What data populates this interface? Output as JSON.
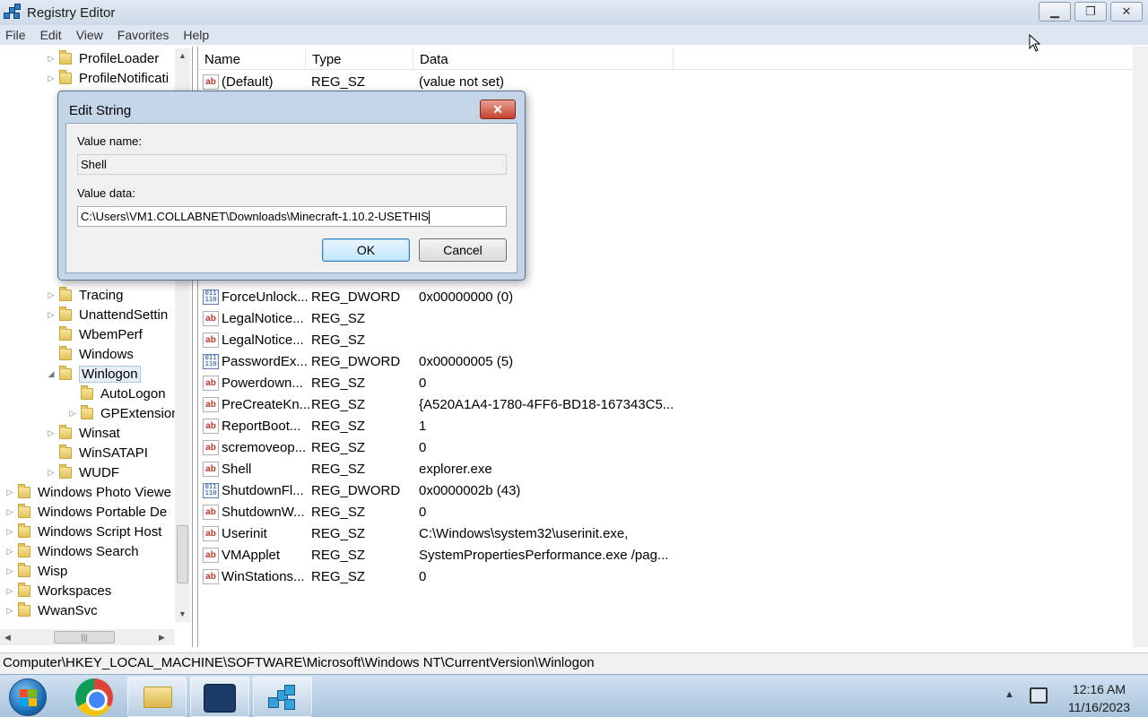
{
  "window": {
    "title": "Registry Editor"
  },
  "menu": [
    "File",
    "Edit",
    "View",
    "Favorites",
    "Help"
  ],
  "tree": {
    "items": [
      {
        "label": "ProfileLoader",
        "indent": 2,
        "expander": "closed"
      },
      {
        "label": "ProfileNotificati",
        "indent": 2,
        "expander": "closed"
      },
      {
        "label": "Tracing",
        "indent": 2,
        "expander": "closed"
      },
      {
        "label": "UnattendSettin",
        "indent": 2,
        "expander": "closed"
      },
      {
        "label": "WbemPerf",
        "indent": 2,
        "expander": "none"
      },
      {
        "label": "Windows",
        "indent": 2,
        "expander": "none"
      },
      {
        "label": "Winlogon",
        "indent": 2,
        "expander": "open",
        "selected": true
      },
      {
        "label": "AutoLogon",
        "indent": 3,
        "expander": "none"
      },
      {
        "label": "GPExtension",
        "indent": 3,
        "expander": "closed"
      },
      {
        "label": "Winsat",
        "indent": 2,
        "expander": "closed"
      },
      {
        "label": "WinSATAPI",
        "indent": 2,
        "expander": "none"
      },
      {
        "label": "WUDF",
        "indent": 2,
        "expander": "closed"
      },
      {
        "label": "Windows Photo Viewe",
        "indent": 0,
        "expander": "closed"
      },
      {
        "label": "Windows Portable De",
        "indent": 0,
        "expander": "closed"
      },
      {
        "label": "Windows Script Host",
        "indent": 0,
        "expander": "closed"
      },
      {
        "label": "Windows Search",
        "indent": 0,
        "expander": "closed"
      },
      {
        "label": "Wisp",
        "indent": 0,
        "expander": "closed"
      },
      {
        "label": "Workspaces",
        "indent": 0,
        "expander": "closed"
      },
      {
        "label": "WwanSvc",
        "indent": 0,
        "expander": "closed"
      }
    ]
  },
  "list": {
    "columns": [
      "Name",
      "Type",
      "Data"
    ],
    "rows": [
      {
        "icon": "string-value-icon",
        "name": "(Default)",
        "type": "REG_SZ",
        "data": "(value not set)"
      },
      {
        "icon": "binary-value-icon",
        "name": "ForceUnlock...",
        "type": "REG_DWORD",
        "data": "0x00000000 (0)"
      },
      {
        "icon": "string-value-icon",
        "name": "LegalNotice...",
        "type": "REG_SZ",
        "data": ""
      },
      {
        "icon": "string-value-icon",
        "name": "LegalNotice...",
        "type": "REG_SZ",
        "data": ""
      },
      {
        "icon": "binary-value-icon",
        "name": "PasswordEx...",
        "type": "REG_DWORD",
        "data": "0x00000005 (5)"
      },
      {
        "icon": "string-value-icon",
        "name": "Powerdown...",
        "type": "REG_SZ",
        "data": "0"
      },
      {
        "icon": "string-value-icon",
        "name": "PreCreateKn...",
        "type": "REG_SZ",
        "data": "{A520A1A4-1780-4FF6-BD18-167343C5..."
      },
      {
        "icon": "string-value-icon",
        "name": "ReportBoot...",
        "type": "REG_SZ",
        "data": "1"
      },
      {
        "icon": "string-value-icon",
        "name": "scremoveop...",
        "type": "REG_SZ",
        "data": "0"
      },
      {
        "icon": "string-value-icon",
        "name": "Shell",
        "type": "REG_SZ",
        "data": "explorer.exe"
      },
      {
        "icon": "binary-value-icon",
        "name": "ShutdownFl...",
        "type": "REG_DWORD",
        "data": "0x0000002b (43)"
      },
      {
        "icon": "string-value-icon",
        "name": "ShutdownW...",
        "type": "REG_SZ",
        "data": "0"
      },
      {
        "icon": "string-value-icon",
        "name": "Userinit",
        "type": "REG_SZ",
        "data": "C:\\Windows\\system32\\userinit.exe,"
      },
      {
        "icon": "string-value-icon",
        "name": "VMApplet",
        "type": "REG_SZ",
        "data": "SystemPropertiesPerformance.exe /pag..."
      },
      {
        "icon": "string-value-icon",
        "name": "WinStations...",
        "type": "REG_SZ",
        "data": "0"
      }
    ]
  },
  "status": {
    "path": "Computer\\HKEY_LOCAL_MACHINE\\SOFTWARE\\Microsoft\\Windows NT\\CurrentVersion\\Winlogon"
  },
  "dialog": {
    "title": "Edit String",
    "close_label": "✕",
    "value_name_label": "Value name:",
    "value_name": "Shell",
    "value_data_label": "Value data:",
    "value_data": "C:\\Users\\VM1.COLLABNET\\Downloads\\Minecraft-1.10.2-USETHIS",
    "ok_label": "OK",
    "cancel_label": "Cancel"
  },
  "taskbar": {
    "apps": [
      "start-button",
      "chrome-icon",
      "file-explorer-icon",
      "app-icon",
      "registry-editor-icon"
    ],
    "time": "12:16 AM",
    "date": "11/16/2023"
  }
}
